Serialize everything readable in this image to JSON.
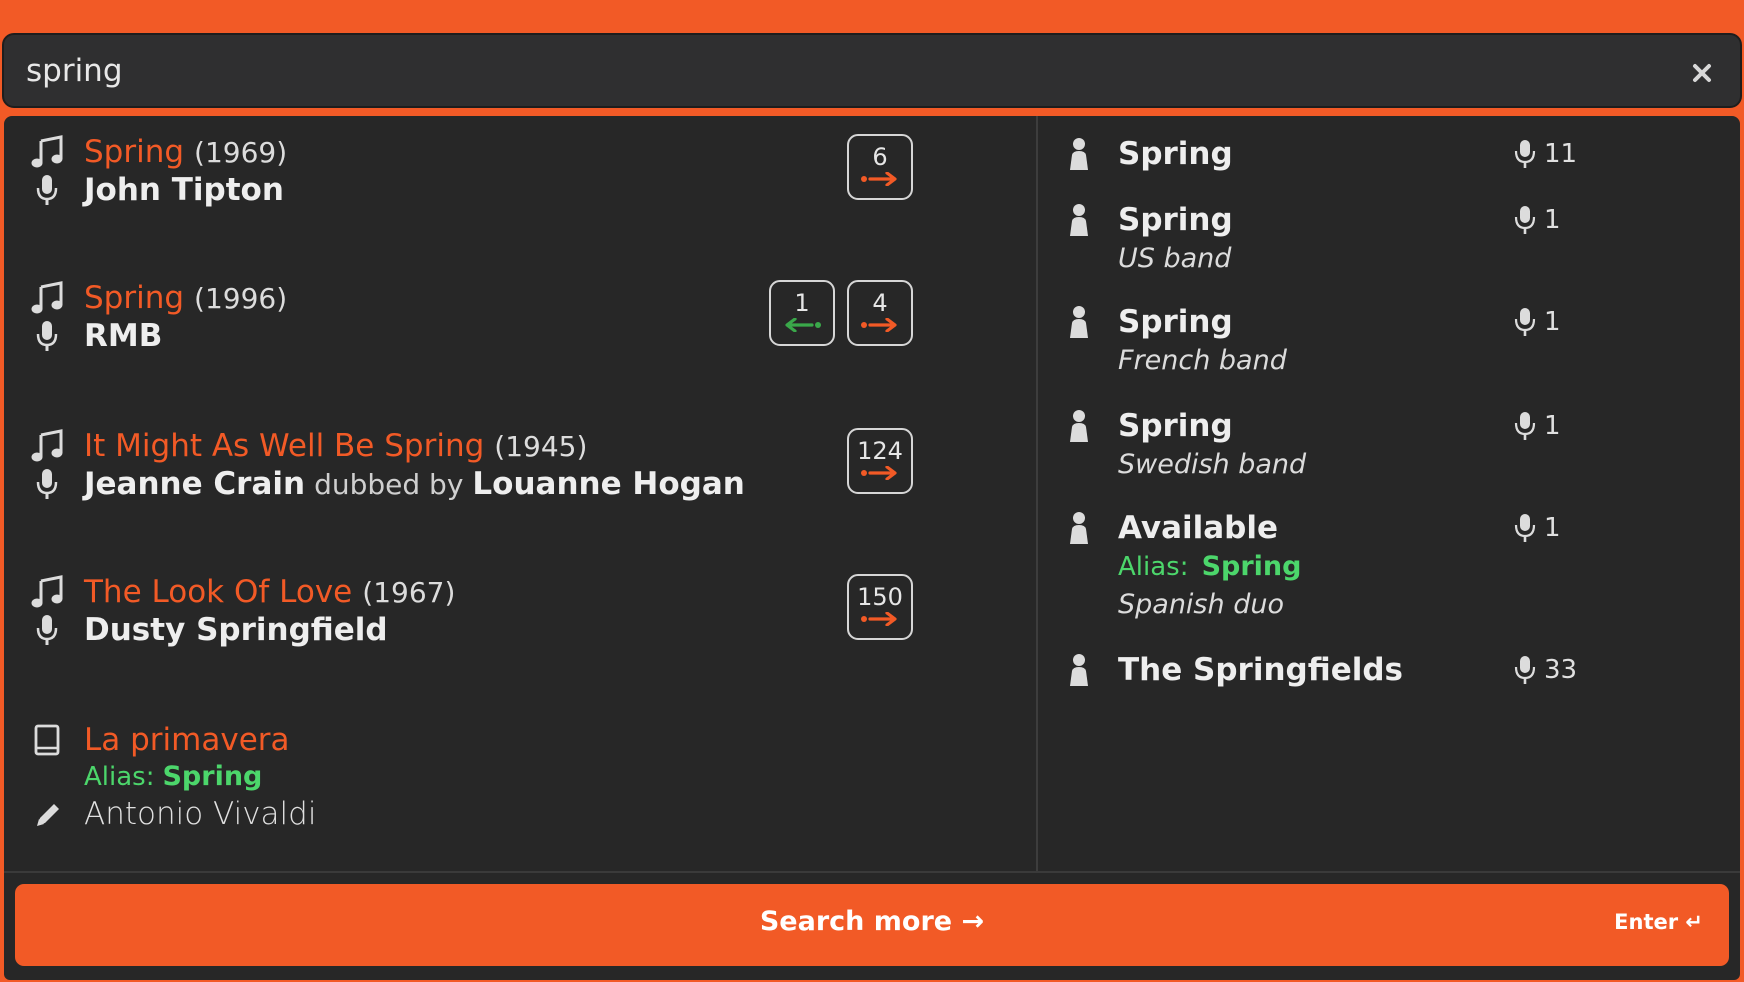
{
  "search": {
    "value": "spring",
    "clear_icon": "close-icon"
  },
  "recordings": [
    {
      "title": "Spring",
      "year": "(1969)",
      "artist": "John Tipton",
      "badges": [
        {
          "count": "6",
          "direction": "forward",
          "color": "#f25a26"
        }
      ]
    },
    {
      "title": "Spring",
      "year": "(1996)",
      "artist": "RMB",
      "badges": [
        {
          "count": "1",
          "direction": "back",
          "color": "#3aa84a"
        },
        {
          "count": "4",
          "direction": "forward",
          "color": "#f25a26"
        }
      ]
    },
    {
      "title": "It Might As Well Be Spring",
      "year": "(1945)",
      "artist": "Jeanne Crain",
      "dubbed_by_label": "dubbed by",
      "dubbed_by": "Louanne Hogan",
      "badges": [
        {
          "count": "124",
          "direction": "forward",
          "color": "#f25a26"
        }
      ]
    },
    {
      "title": "The Look Of Love",
      "year": "(1967)",
      "artist": "Dusty Springfield",
      "badges": [
        {
          "count": "150",
          "direction": "forward",
          "color": "#f25a26"
        }
      ]
    }
  ],
  "work": {
    "title": "La primavera",
    "alias_label": "Alias:",
    "alias": "Spring",
    "composer": "Antonio Vivaldi"
  },
  "artists": [
    {
      "name": "Spring",
      "count": "11"
    },
    {
      "name": "Spring",
      "count": "1",
      "description": "US band"
    },
    {
      "name": "Spring",
      "count": "1",
      "description": "French band"
    },
    {
      "name": "Spring",
      "count": "1",
      "description": "Swedish band"
    },
    {
      "name": "Available",
      "count": "1",
      "alias_label": "Alias:",
      "alias": "Spring",
      "description": "Spanish duo"
    },
    {
      "name": "The Springfields",
      "count": "33"
    }
  ],
  "footer": {
    "search_more": "Search more →",
    "enter_hint": "Enter ↵"
  },
  "colors": {
    "accent": "#f25a26",
    "background": "#272727",
    "alias_green": "#4cd66b",
    "back_arrow_green": "#3aa84a"
  }
}
